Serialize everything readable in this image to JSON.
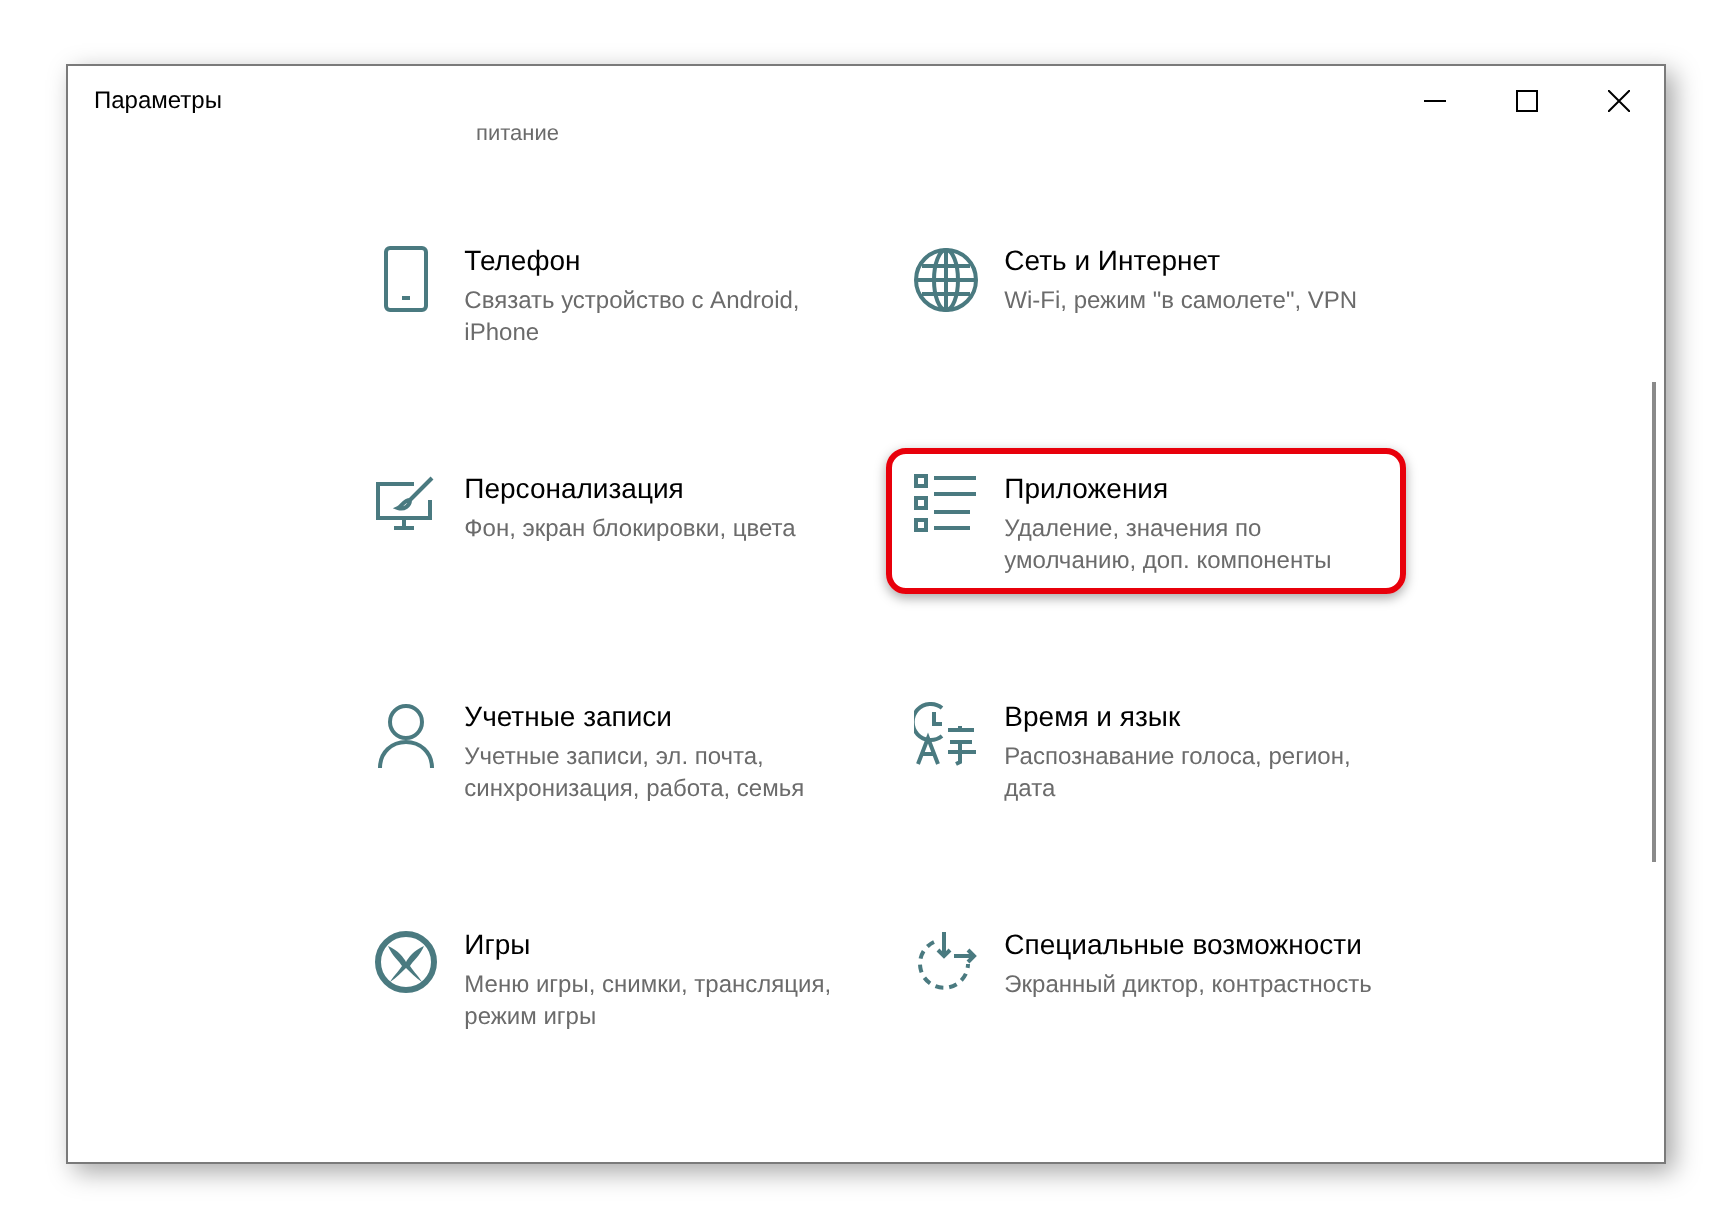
{
  "window": {
    "title": "Параметры"
  },
  "top_fragment": "питание",
  "items": [
    {
      "kind": "phone",
      "title": "Телефон",
      "description": "Связать устройство с Android, iPhone",
      "highlighted": false
    },
    {
      "kind": "network",
      "title": "Сеть и Интернет",
      "description": "Wi-Fi, режим \"в самолете\", VPN",
      "highlighted": false
    },
    {
      "kind": "personalization",
      "title": "Персонализация",
      "description": "Фон, экран блокировки, цвета",
      "highlighted": false
    },
    {
      "kind": "apps",
      "title": "Приложения",
      "description": "Удаление, значения по умолчанию, доп. компоненты",
      "highlighted": true
    },
    {
      "kind": "accounts",
      "title": "Учетные записи",
      "description": "Учетные записи, эл. почта, синхронизация, работа, семья",
      "highlighted": false
    },
    {
      "kind": "time",
      "title": "Время и язык",
      "description": "Распознавание голоса, регион, дата",
      "highlighted": false
    },
    {
      "kind": "gaming",
      "title": "Игры",
      "description": "Меню игры, снимки, трансляция, режим игры",
      "highlighted": false
    },
    {
      "kind": "accessibility",
      "title": "Специальные возможности",
      "description": "Экранный диктор, контрастность",
      "highlighted": false
    }
  ]
}
